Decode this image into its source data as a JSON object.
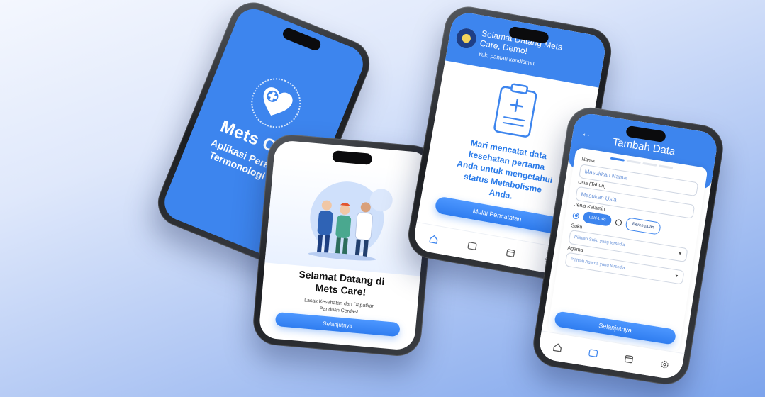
{
  "splash": {
    "brand_name": "Mets Care",
    "tagline_1": "Aplikasi Perawatan",
    "tagline_2": "Termonologi Awal"
  },
  "onboarding": {
    "title_1": "Selamat Datang di",
    "title_2": "Mets Care!",
    "subtitle_1": "Lacak Kesehatan dan Dapatkan",
    "subtitle_2": "Panduan Cerdas!",
    "next_label": "Selanjutnya"
  },
  "home": {
    "greeting_1": "Selamat Datang Mets",
    "greeting_2": "Care, Demo!",
    "greeting_sub": "Yuk, pantau kondisimu.",
    "message_1": "Mari mencatat data",
    "message_2": "kesehatan pertama",
    "message_3": "Anda untuk mengetahui",
    "message_4": "status Metabolisme",
    "message_5": "Anda.",
    "start_label": "Mulai Pencatatan"
  },
  "form": {
    "title": "Tambah Data",
    "name_label": "Nama",
    "name_placeholder": "Masukkan Nama",
    "age_label": "Usia (Tahun)",
    "age_placeholder": "Masukan Usia",
    "gender_label": "Jenis Kelamin",
    "gender_male": "Laki-Laki",
    "gender_female": "Perempuan",
    "tribe_label": "Suku",
    "tribe_placeholder": "Pilihlah Suku yang tersedia",
    "religion_label": "Agama",
    "religion_placeholder": "Pilihlah Agama yang tersedia",
    "next_label": "Selanjutnya"
  },
  "colors": {
    "primary": "#3d85ee",
    "accent_text": "#2a7be9"
  }
}
